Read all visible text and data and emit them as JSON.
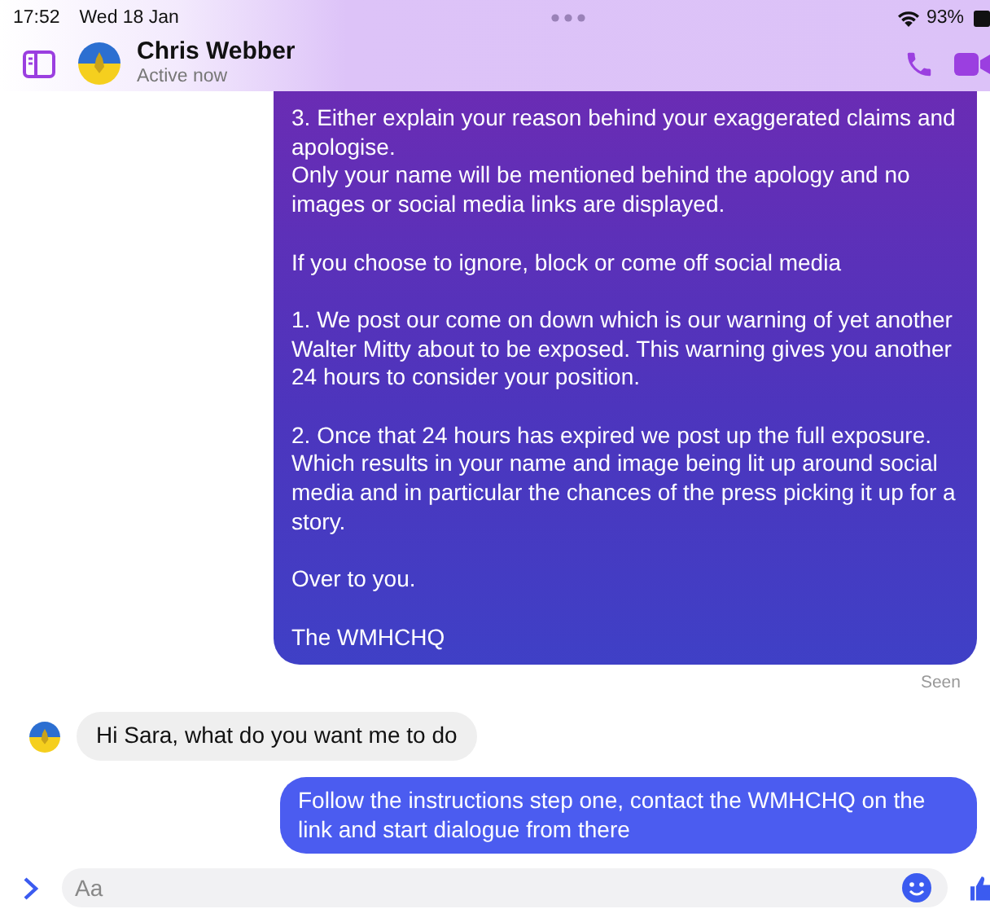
{
  "status_bar": {
    "time": "17:52",
    "date": "Wed 18 Jan",
    "battery": "93%"
  },
  "header": {
    "name": "Chris Webber",
    "presence": "Active now"
  },
  "messages": [
    {
      "kind": "outgoing",
      "paragraphs": [
        "3. Either explain your reason behind your exaggerated claims and apologise.\nOnly your name will be mentioned behind the apology and no images or social media links are displayed.",
        "If you choose to ignore, block or come off social media",
        "1. We post our come on down which is our warning of yet another Walter Mitty about to be exposed. This warning gives you another 24 hours to consider your position.",
        "2. Once that 24 hours has expired we post up the full exposure. Which results in your name and image being lit up around social media and in particular the chances of the press picking it up for a story.",
        "Over to you.",
        "The WMHCHQ"
      ],
      "receipt": "Seen",
      "cut_top": true
    },
    {
      "kind": "incoming",
      "paragraphs": [
        "Hi Sara, what do you want me to do"
      ]
    },
    {
      "kind": "outgoing",
      "paragraphs": [
        "Follow the instructions step one, contact the WMHCHQ on the link and start dialogue from there"
      ]
    }
  ],
  "composer": {
    "placeholder": "Aa"
  }
}
